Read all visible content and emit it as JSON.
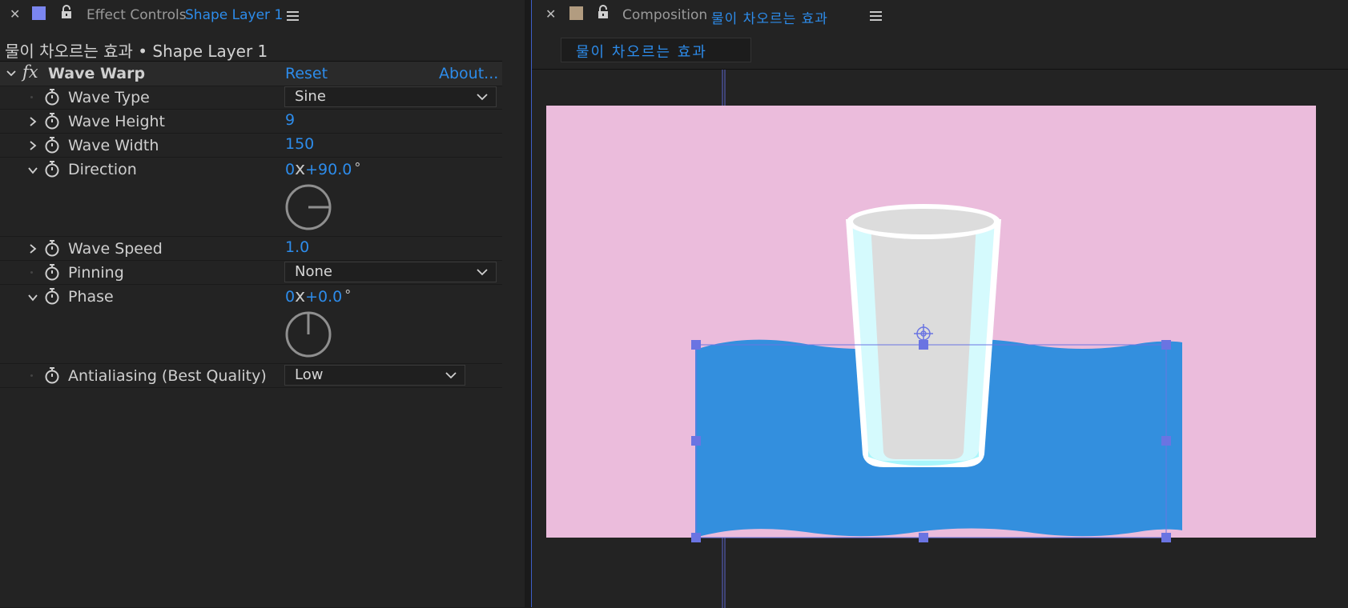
{
  "effect_controls": {
    "tab_prefix": "Effect Controls",
    "tab_layer": "Shape Layer 1",
    "swatch_color": "#7b86f0",
    "layer_path": "물이 차오르는 효과 • Shape Layer 1",
    "effect": {
      "fx_icon": "fx",
      "name": "Wave Warp",
      "reset_label": "Reset",
      "about_label": "About..."
    },
    "properties": {
      "wave_type": {
        "label": "Wave Type",
        "value": "Sine"
      },
      "wave_height": {
        "label": "Wave Height",
        "value": "9"
      },
      "wave_width": {
        "label": "Wave Width",
        "value": "150"
      },
      "direction": {
        "label": "Direction",
        "rev": "0",
        "x": "x",
        "angle": "+90.0",
        "deg": "°",
        "angle_degrees": 90
      },
      "wave_speed": {
        "label": "Wave Speed",
        "value": "1.0"
      },
      "pinning": {
        "label": "Pinning",
        "value": "None"
      },
      "phase": {
        "label": "Phase",
        "rev": "0",
        "x": "x",
        "angle": "+0.0",
        "deg": "°",
        "angle_degrees": 0
      },
      "antialiasing": {
        "label": "Antialiasing (Best Quality)",
        "value": "Low"
      }
    }
  },
  "composition": {
    "tab_prefix": "Composition",
    "tab_name": "물이 차오르는 효과",
    "swatch_color": "#b29c80",
    "comp_tab_label": "물이 차오르는 효과",
    "canvas_background": "#ebbcdc",
    "water_color": "#338fde",
    "selection_color": "#6a74e2"
  }
}
